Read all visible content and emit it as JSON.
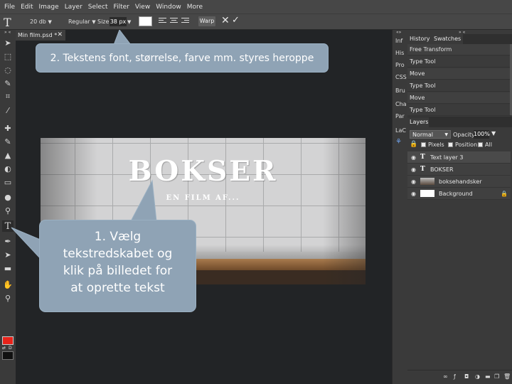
{
  "menu": [
    "File",
    "Edit",
    "Image",
    "Layer",
    "Select",
    "Filter",
    "View",
    "Window",
    "More"
  ],
  "options": {
    "font_size_preset": "20 db",
    "font_style": "Regular",
    "size_label": "Size:",
    "size_value": "38 px",
    "warp_label": "Warp",
    "text_color": "#ffffff"
  },
  "document": {
    "tab_title": "Min film.psd *",
    "title_text": "BOKSER",
    "subtitle_text": "EN FILM AF..."
  },
  "callouts": {
    "top": "2. Tekstens font, størrelse, farve mm. styres heroppe",
    "bottom_lines": [
      "1. Vælg",
      "tekstredskabet og",
      "klik på billedet for",
      "at oprette tekst"
    ]
  },
  "side_icons": [
    "Inf",
    "His",
    "Pro",
    "CSS",
    "Bru",
    "Cha",
    "Par",
    "LaC"
  ],
  "history": {
    "tabs": [
      "History",
      "Swatches"
    ],
    "items": [
      "Free Transform",
      "Type Tool",
      "Move",
      "Type Tool",
      "Move",
      "Type Tool"
    ]
  },
  "layers": {
    "tab": "Layers",
    "blend_mode": "Normal",
    "opacity_label": "Opacity:",
    "opacity_value": "100%",
    "lock_labels": [
      "Pixels",
      "Position",
      "All"
    ],
    "items": [
      {
        "name": "Text layer 3",
        "kind": "text-icon"
      },
      {
        "name": "BOKSER",
        "kind": "text-icon"
      },
      {
        "name": "boksehandsker",
        "kind": "image-thumb"
      },
      {
        "name": "Background",
        "kind": "white-thumb"
      }
    ]
  },
  "colors": {
    "foreground": "#e8231a",
    "background": "#111111",
    "callout": "#8fa3b5"
  },
  "toolbar_labels": {
    "swap": "⇄",
    "default": "D"
  },
  "footer_icons": [
    "link-icon",
    "effects-icon",
    "mask-icon",
    "adjustment-icon",
    "folder-icon",
    "new-layer-icon",
    "trash-icon"
  ]
}
